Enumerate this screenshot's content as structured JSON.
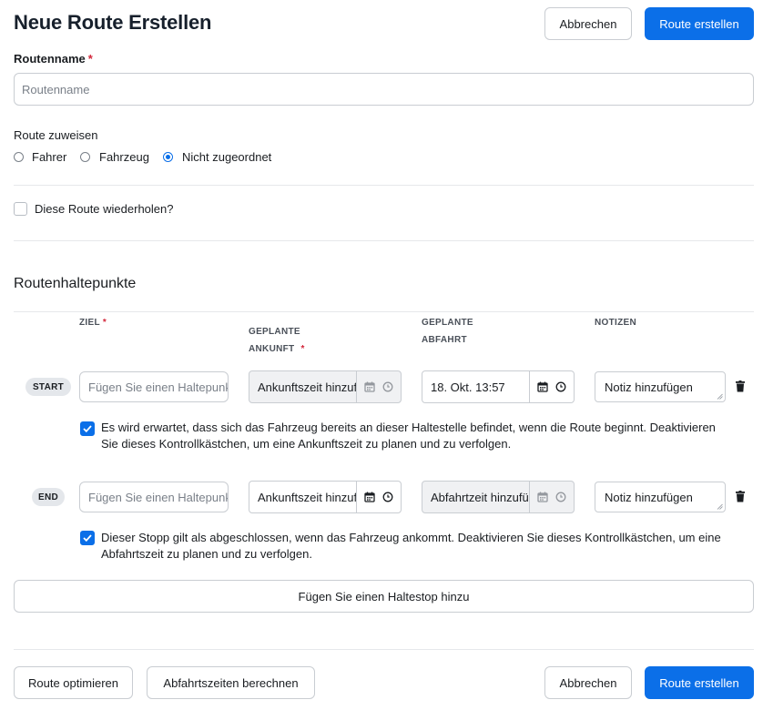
{
  "header": {
    "title": "Neue Route Erstellen",
    "cancel_label": "Abbrechen",
    "create_label": "Route erstellen"
  },
  "route_name": {
    "label": "Routenname",
    "required_mark": "*",
    "placeholder": "Routenname",
    "value": ""
  },
  "assign": {
    "label": "Route zuweisen",
    "options": [
      "Fahrer",
      "Fahrzeug",
      "Nicht zugeordnet"
    ],
    "selected": "Nicht zugeordnet"
  },
  "repeat": {
    "label": "Diese Route wiederholen?",
    "checked": false
  },
  "stops_section": {
    "title": "Routenhaltepunkte",
    "columns": {
      "ziel": "ZIEL",
      "ankunft": "GEPLANTE ANKUNFT",
      "abfahrt": "GEPLANTE ABFAHRT",
      "notizen": "NOTIZEN"
    },
    "required_mark": "*",
    "stops": [
      {
        "badge": "START",
        "destination_placeholder": "Fügen Sie einen Haltepunkt hinzu",
        "arrival_text": "Ankunftszeit hinzufügen",
        "arrival_enabled": false,
        "departure_text": "18. Okt. 13:57",
        "departure_enabled": true,
        "note_text": "Notiz hinzufügen",
        "checkbox_checked": true,
        "checkbox_text_1": "Es wird erwartet, dass sich das Fahrzeug bereits an dieser Haltestelle befindet, wenn die Route beginnt. Deaktivieren",
        "checkbox_text_2": "Sie dieses Kontrollkästchen, um eine Ankunftszeit zu planen und zu verfolgen."
      },
      {
        "badge": "END",
        "destination_placeholder": "Fügen Sie einen Haltepunkt hinzu",
        "arrival_text": "Ankunftszeit hinzufügen",
        "arrival_enabled": true,
        "departure_text": "Abfahrtzeit hinzufügen",
        "departure_enabled": false,
        "note_text": "Notiz hinzufügen",
        "checkbox_checked": true,
        "checkbox_text_1": "Dieser Stopp gilt als abgeschlossen, wenn das Fahrzeug ankommt. Deaktivieren Sie dieses Kontrollkästchen, um eine",
        "checkbox_text_2": "Abfahrtszeit zu planen und zu verfolgen."
      }
    ],
    "add_stop_label": "Fügen Sie einen Haltestop hinzu"
  },
  "footer": {
    "optimize_label": "Route optimieren",
    "calc_label": "Abfahrtszeiten berechnen",
    "cancel_label": "Abbrechen",
    "create_label": "Route erstellen"
  },
  "colors": {
    "primary": "#0b6fe8",
    "required": "#d3263a",
    "border": "#c9cdd2"
  },
  "icons": [
    "calendar-icon",
    "clock-icon",
    "trash-icon",
    "check-icon",
    "resize-grip-icon"
  ]
}
